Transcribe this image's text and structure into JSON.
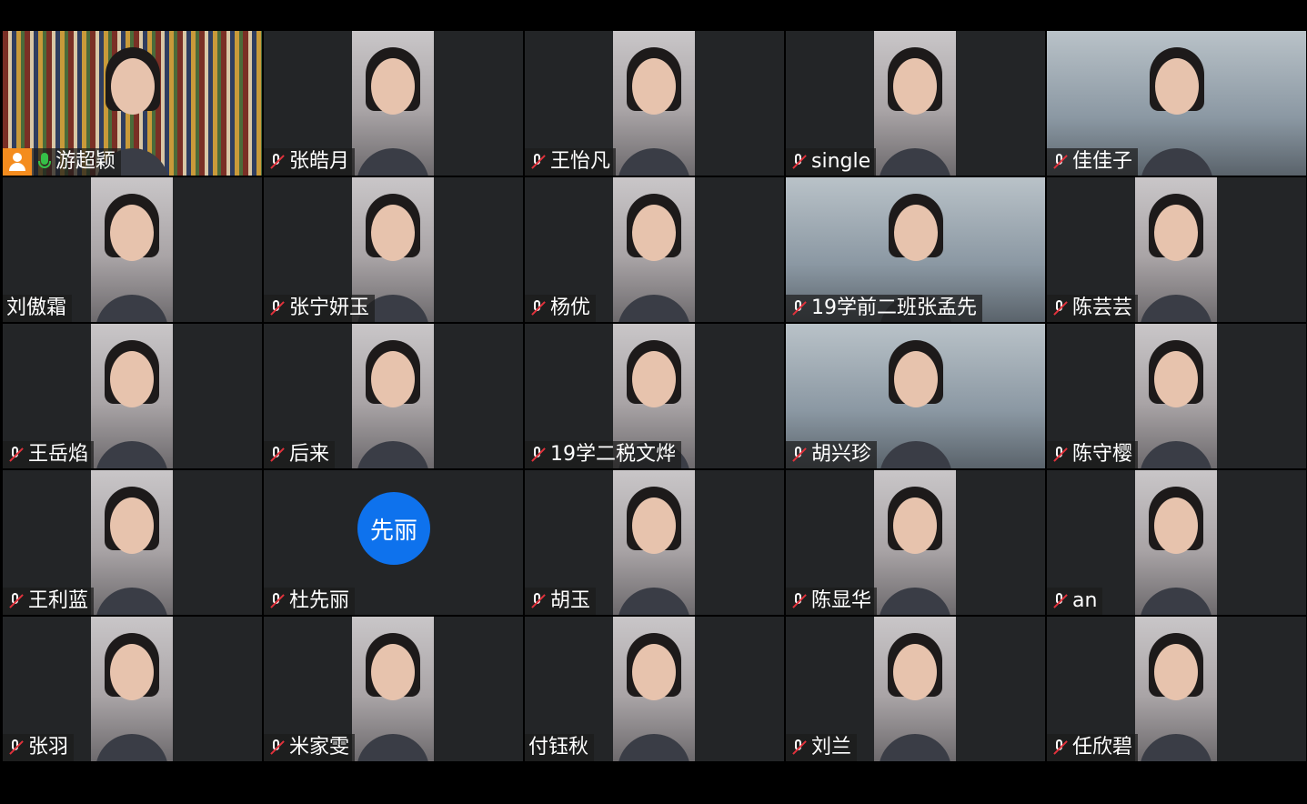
{
  "meeting": {
    "participants": [
      {
        "name": "游超颖",
        "mic": "on",
        "host": true,
        "active": true,
        "video": "books"
      },
      {
        "name": "张皓月",
        "mic": "muted",
        "video": "portrait"
      },
      {
        "name": "王怡凡",
        "mic": "muted",
        "video": "portrait"
      },
      {
        "name": "single",
        "mic": "muted",
        "video": "portrait"
      },
      {
        "name": "佳佳子",
        "mic": "muted",
        "video": "wide"
      },
      {
        "name": "刘傲霜",
        "mic": "none",
        "video": "portrait"
      },
      {
        "name": "张宁妍玉",
        "mic": "muted",
        "video": "portrait"
      },
      {
        "name": "杨优",
        "mic": "muted",
        "video": "portrait"
      },
      {
        "name": "19学前二班张孟先",
        "mic": "muted",
        "video": "wide"
      },
      {
        "name": "陈芸芸",
        "mic": "muted",
        "video": "portrait"
      },
      {
        "name": "王岳焰",
        "mic": "muted",
        "video": "portrait"
      },
      {
        "name": "后来",
        "mic": "muted",
        "video": "portrait"
      },
      {
        "name": "19学二税文烨",
        "mic": "muted",
        "video": "portrait"
      },
      {
        "name": "胡兴珍",
        "mic": "muted",
        "video": "wide"
      },
      {
        "name": "陈守樱",
        "mic": "muted",
        "video": "portrait"
      },
      {
        "name": "王利蓝",
        "mic": "muted",
        "video": "portrait"
      },
      {
        "name": "杜先丽",
        "mic": "muted",
        "video": "none",
        "avatar_text": "先丽"
      },
      {
        "name": "胡玉",
        "mic": "muted",
        "video": "portrait"
      },
      {
        "name": "陈显华",
        "mic": "muted",
        "video": "portrait"
      },
      {
        "name": "an",
        "mic": "muted",
        "video": "portrait"
      },
      {
        "name": "张羽",
        "mic": "muted",
        "video": "portrait"
      },
      {
        "name": "米家雯",
        "mic": "muted",
        "video": "portrait"
      },
      {
        "name": "付钰秋",
        "mic": "none",
        "video": "portrait"
      },
      {
        "name": "刘兰",
        "mic": "muted",
        "video": "portrait"
      },
      {
        "name": "任欣碧",
        "mic": "muted",
        "video": "portrait"
      }
    ]
  },
  "colors": {
    "tile_bg": "#232527",
    "active_border": "#3fbf5f",
    "muted_slash": "#e2323c",
    "mic_on": "#36c048",
    "host_badge": "#f48c1e",
    "avatar_bg": "#0e72ed"
  },
  "icons": {
    "muted": "microphone-muted-icon",
    "on": "microphone-icon",
    "host": "host-person-icon"
  }
}
